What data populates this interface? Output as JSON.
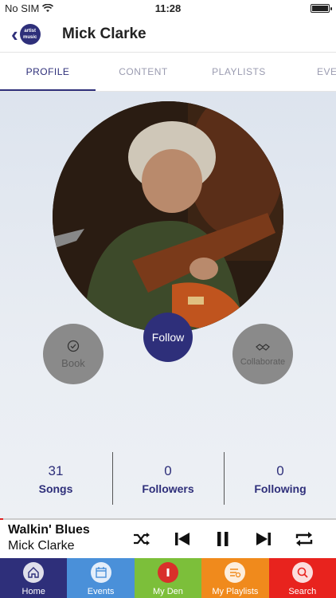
{
  "status_bar": {
    "carrier": "No SIM",
    "time": "11:28"
  },
  "header": {
    "back_icon": "chevron-left-icon",
    "logo_text": "artist music",
    "title": "Mick Clarke"
  },
  "tabs": [
    {
      "label": "PROFILE",
      "active": true
    },
    {
      "label": "CONTENT",
      "active": false
    },
    {
      "label": "PLAYLISTS",
      "active": false
    },
    {
      "label": "EVE",
      "active": false
    }
  ],
  "actions": {
    "book_label": "Book",
    "follow_label": "Follow",
    "collaborate_label": "Collaborate"
  },
  "stats": [
    {
      "count": "31",
      "label": "Songs"
    },
    {
      "count": "0",
      "label": "Followers"
    },
    {
      "count": "0",
      "label": "Following"
    }
  ],
  "player": {
    "title": "Walkin' Blues",
    "artist": "Mick Clarke",
    "progress": 0.01,
    "controls": [
      "shuffle-icon",
      "previous-icon",
      "pause-icon",
      "next-icon",
      "repeat-icon"
    ]
  },
  "bottom_nav": [
    {
      "label": "Home",
      "icon": "home-icon",
      "color": "#2e2f7a"
    },
    {
      "label": "Events",
      "icon": "calendar-icon",
      "color": "#4a90d9"
    },
    {
      "label": "My Den",
      "icon": "den-icon",
      "color": "#7cbf3a"
    },
    {
      "label": "My Playlists",
      "icon": "playlist-icon",
      "color": "#f08a1c"
    },
    {
      "label": "Search",
      "icon": "search-icon",
      "color": "#e8231e"
    }
  ],
  "colors": {
    "accent": "#2e2f7a",
    "progress": "#e02020"
  }
}
